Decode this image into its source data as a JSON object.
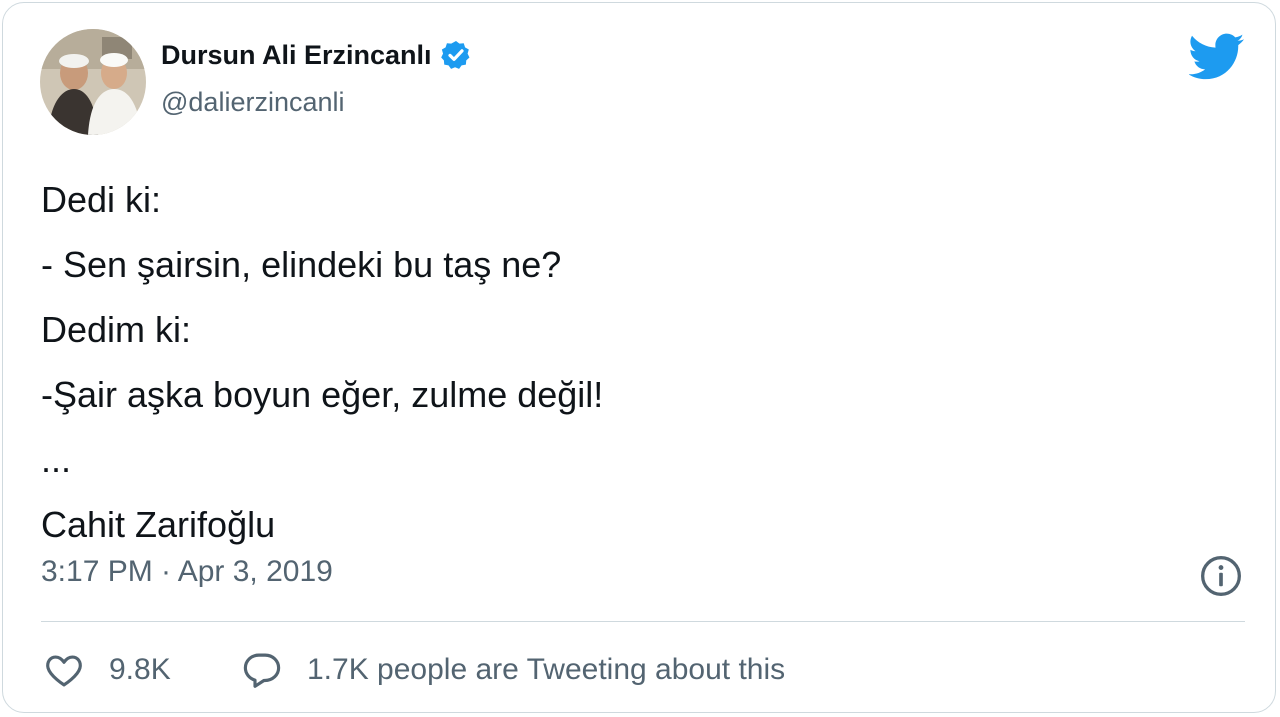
{
  "tweet": {
    "author_name": "Dursun Ali Erzincanlı",
    "handle": "@dalierzincanli",
    "text_lines": [
      "Dedi ki:",
      "- Sen şairsin, elindeki bu taş ne?",
      "Dedim ki:",
      "-Şair aşka boyun eğer, zulme değil!",
      "...",
      "Cahit Zarifoğlu"
    ],
    "timestamp": "3:17 PM · Apr 3, 2019",
    "likes": "9.8K",
    "engagement_text": "1.7K people are Tweeting about this"
  },
  "icons": {
    "verified": "verified-badge-icon",
    "bird": "twitter-bird-icon",
    "info": "info-icon",
    "like": "heart-icon",
    "reply": "speech-bubble-icon"
  },
  "colors": {
    "brand": "#1d9bf0",
    "text": "#0f1419",
    "secondary": "#536471",
    "border": "#cfd9de"
  }
}
